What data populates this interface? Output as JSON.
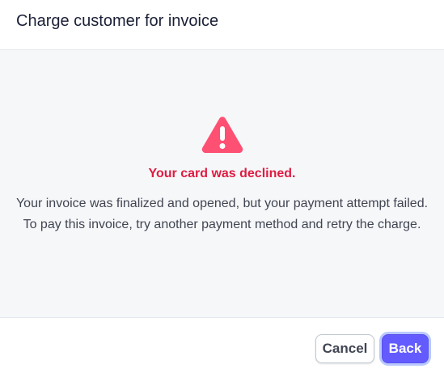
{
  "dialog": {
    "title": "Charge customer for invoice"
  },
  "error": {
    "icon": "warning-triangle-icon",
    "title": "Your card was declined.",
    "message": "Your invoice was finalized and opened, but your payment attempt failed. To pay this invoice, try another payment method and retry the charge."
  },
  "footer": {
    "cancel_label": "Cancel",
    "back_label": "Back"
  },
  "colors": {
    "error_red": "#df1b41",
    "icon_red": "#fe5073",
    "primary": "#635bff",
    "focus_ring": "#b9c9ff",
    "body_bg": "#f6f7f9"
  }
}
